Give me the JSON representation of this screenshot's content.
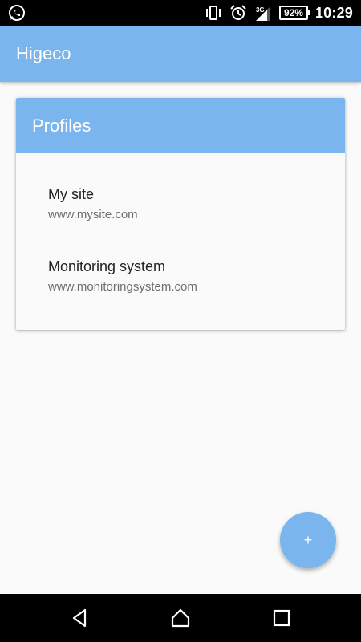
{
  "status_bar": {
    "battery": "92%",
    "time": "10:29",
    "network": "3G",
    "icons": [
      "whatsapp-icon",
      "vibrate-icon",
      "alarm-icon",
      "signal-icon",
      "battery-icon"
    ]
  },
  "app_bar": {
    "title": "Higeco"
  },
  "profiles_card": {
    "title": "Profiles",
    "items": [
      {
        "name": "My site",
        "url": "www.mysite.com"
      },
      {
        "name": "Monitoring system",
        "url": "www.monitoringsystem.com"
      }
    ]
  },
  "fab": {
    "label": "+"
  },
  "colors": {
    "primary": "#7ab5ee",
    "background": "#fafafa",
    "status_bar": "#000000"
  },
  "nav_bar": {
    "icons": [
      "back-icon",
      "home-icon",
      "recents-icon"
    ]
  }
}
